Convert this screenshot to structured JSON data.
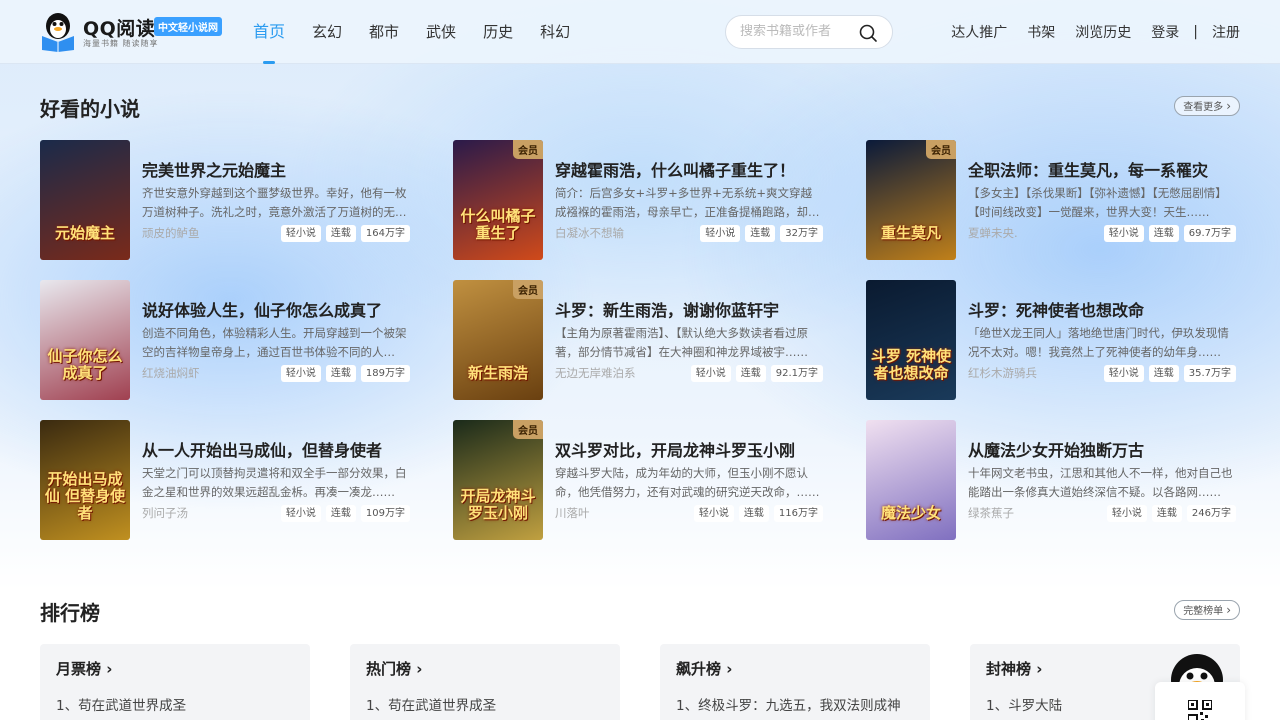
{
  "header": {
    "logo_title": "QQ阅读",
    "logo_badge": "中文轻小说网",
    "logo_slogan": "海量书籍 随读随享",
    "nav": [
      "首页",
      "玄幻",
      "都市",
      "武侠",
      "历史",
      "科幻"
    ],
    "search_placeholder": "搜索书籍或作者",
    "links": {
      "promo": "达人推广",
      "shelf": "书架",
      "history": "浏览历史",
      "login": "登录",
      "sep": "|",
      "register": "注册"
    }
  },
  "section1": {
    "title": "好看的小说",
    "more": "查看更多",
    "books": [
      {
        "title": "完美世界之元始魔主",
        "desc": "齐世安意外穿越到这个噩梦级世界。幸好，他有一枚万道树种子。洗礼之时，竟意外激活了万道树的无上力量……",
        "author": "顽皮的鲈鱼",
        "tags": [
          "轻小说",
          "连载",
          "164万字"
        ],
        "vip": "",
        "cover_text": "元始魔主",
        "cover_colors": [
          "#1a2a4a",
          "#7a2a1a"
        ]
      },
      {
        "title": "穿越霍雨浩，什么叫橘子重生了！",
        "desc": "简介：后宫多女+斗罗+多世界+无系统+爽文穿越成襁褓的霍雨浩，母亲早亡，正准备提桶跑路，却发现……",
        "author": "白凝冰不想输",
        "tags": [
          "轻小说",
          "连载",
          "32万字"
        ],
        "vip": "会员",
        "cover_text": "什么叫橘子重生了",
        "cover_colors": [
          "#2a1a4a",
          "#d04a1a"
        ]
      },
      {
        "title": "全职法师：重生莫凡，每一系罹灾",
        "desc": "【多女主】【杀伐果断】【弥补遗憾】【无憋屈剧情】【时间线改变】一觉醒来，世界大变！天生……",
        "author": "夏蝉未央.",
        "tags": [
          "轻小说",
          "连载",
          "69.7万字"
        ],
        "vip": "会员",
        "cover_text": "重生莫凡",
        "cover_colors": [
          "#0a1a3a",
          "#c0801a"
        ]
      },
      {
        "title": "说好体验人生，仙子你怎么成真了",
        "desc": "创造不同角色，体验精彩人生。开局穿越到一个被架空的吉祥物皇帝身上，通过百世书体验不同的人生……",
        "author": "红烧油焖虾",
        "tags": [
          "轻小说",
          "连载",
          "189万字"
        ],
        "vip": "",
        "cover_text": "仙子你怎么成真了",
        "cover_colors": [
          "#e8e8ee",
          "#a04050"
        ]
      },
      {
        "title": "斗罗：新生雨浩，谢谢你蓝轩宇",
        "desc": "【主角为原著霍雨浩】、【默认绝大多数读者看过原著，部分情节减省】在大神圈和神龙界域被宇……",
        "author": "无边无岸难泊系",
        "tags": [
          "轻小说",
          "连载",
          "92.1万字"
        ],
        "vip": "会员",
        "cover_text": "新生雨浩",
        "cover_colors": [
          "#c09040",
          "#6a4010"
        ]
      },
      {
        "title": "斗罗：死神使者也想改命",
        "desc": "「绝世X龙王同人」落地绝世唐门时代，伊玖发现情况不太对。嗯！我竟然上了死神使者的幼年身……",
        "author": "红杉木游骑兵",
        "tags": [
          "轻小说",
          "连载",
          "35.7万字"
        ],
        "vip": "",
        "cover_text": "斗罗 死神使者也想改命",
        "cover_colors": [
          "#0a1a30",
          "#1a3a5a"
        ]
      },
      {
        "title": "从一人开始出马成仙，但替身使者",
        "desc": "天堂之门可以顶替拘灵遣将和双全手一部分效果，白金之星和世界的效果远超乱金柝。再凑一凑龙……",
        "author": "列问子汤",
        "tags": [
          "轻小说",
          "连载",
          "109万字"
        ],
        "vip": "",
        "cover_text": "开始出马成仙 但替身使者",
        "cover_colors": [
          "#3a2a10",
          "#c09020"
        ]
      },
      {
        "title": "双斗罗对比，开局龙神斗罗玉小刚",
        "desc": "穿越斗罗大陆，成为年幼的大师，但玉小刚不愿认命，他凭借努力，还有对武魂的研究逆天改命，……",
        "author": "川落叶",
        "tags": [
          "轻小说",
          "连载",
          "116万字"
        ],
        "vip": "会员",
        "cover_text": "开局龙神斗罗玉小刚",
        "cover_colors": [
          "#1a2a1a",
          "#c0a040"
        ]
      },
      {
        "title": "从魔法少女开始独断万古",
        "desc": "十年网文老书虫，江思和其他人不一样，他对自己也能踏出一条修真大道始终深信不疑。以各路网……",
        "author": "绿茶蕉子",
        "tags": [
          "轻小说",
          "连载",
          "246万字"
        ],
        "vip": "",
        "cover_text": "魔法少女",
        "cover_colors": [
          "#f0e0f0",
          "#8070c0"
        ]
      }
    ]
  },
  "section2": {
    "title": "排行榜",
    "more": "完整榜单",
    "cards": [
      {
        "title": "月票榜",
        "item": "1、苟在武道世界成圣"
      },
      {
        "title": "热门榜",
        "item": "1、苟在武道世界成圣"
      },
      {
        "title": "飙升榜",
        "item": "1、终极斗罗：九选五，我双法则成神"
      },
      {
        "title": "封神榜",
        "item": "1、斗罗大陆"
      }
    ]
  }
}
